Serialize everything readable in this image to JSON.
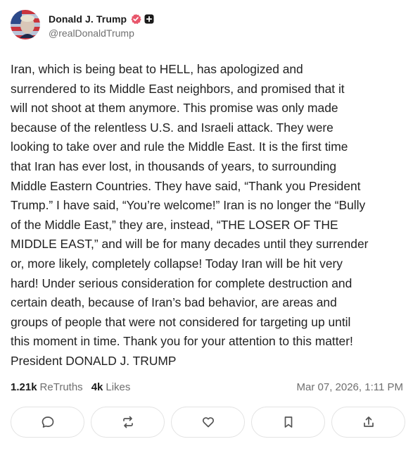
{
  "author": {
    "display_name": "Donald J. Trump",
    "handle": "@realDonaldTrump",
    "avatar_icon": "flag-portrait-avatar",
    "verified_color": "#e8566b"
  },
  "post": {
    "body": "Iran, which is being beat to HELL, has apologized and\nsurrendered to its Middle East neighbors, and promised that it\nwill not shoot at them anymore. This promise was only made\nbecause of the relentless U.S. and Israeli attack. They were\nlooking to take over and rule the Middle East. It is the first time\nthat Iran has ever lost, in thousands of years, to surrounding\nMiddle Eastern Countries. They have said, “Thank you President\nTrump.” I have said, “You’re welcome!” Iran is no longer the “Bully\nof the Middle East,” they are, instead, “THE LOSER OF THE\nMIDDLE EAST,” and will be for many decades until they surrender\nor, more likely, completely collapse! Today Iran will be hit very\nhard! Under serious consideration for complete destruction and\ncertain death, because of Iran’s bad behavior, are areas and\ngroups of people that were not considered for targeting up until\nthis moment in time. Thank you for your attention to this matter!\nPresident DONALD J. TRUMP"
  },
  "stats": {
    "retruths_count": "1.21k",
    "retruths_label": "ReTruths",
    "likes_count": "4k",
    "likes_label": "Likes",
    "timestamp": "Mar 07, 2026, 1:11 PM"
  },
  "actions": [
    {
      "icon": "reply-bubble-icon"
    },
    {
      "icon": "retruth-arrows-icon"
    },
    {
      "icon": "heart-icon"
    },
    {
      "icon": "bookmark-icon"
    },
    {
      "icon": "share-upload-icon"
    }
  ]
}
